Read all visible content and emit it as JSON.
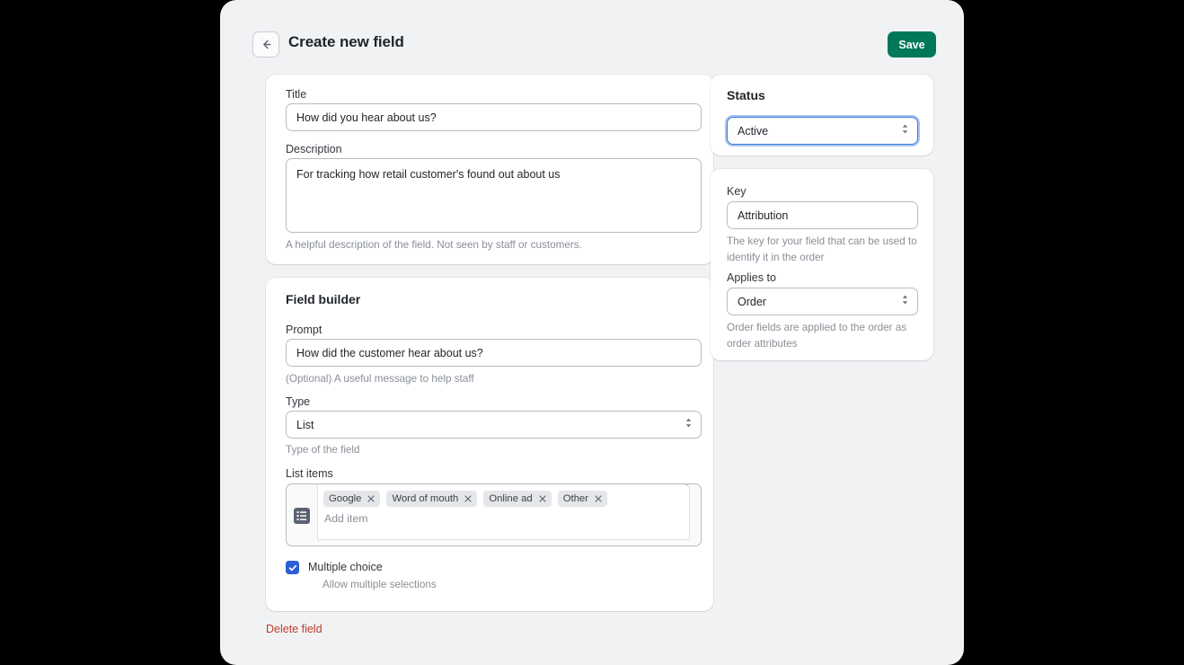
{
  "header": {
    "back_icon": "arrow-left-icon",
    "title": "Create new field",
    "save_label": "Save"
  },
  "basic": {
    "title_label": "Title",
    "title_value": "How did you hear about us?",
    "title_placeholder": "",
    "description_label": "Description",
    "description_value": "For tracking how retail customer's found out about us",
    "description_placeholder": "",
    "description_help": "A helpful description of the field. Not seen by staff or customers."
  },
  "builder": {
    "section_title": "Field builder",
    "prompt_label": "Prompt",
    "prompt_value": "How did the customer hear about us?",
    "prompt_placeholder": "",
    "prompt_help": "(Optional) A useful message to help staff",
    "type_label": "Type",
    "type_value": "List",
    "type_options": [
      "List"
    ],
    "type_help": "Type of the field",
    "list_items_label": "List items",
    "list_icon": "list-icon",
    "items": [
      {
        "label": "Google",
        "remove_icon": "close-icon"
      },
      {
        "label": "Word of mouth",
        "remove_icon": "close-icon"
      },
      {
        "label": "Online ad",
        "remove_icon": "close-icon"
      },
      {
        "label": "Other",
        "remove_icon": "close-icon"
      }
    ],
    "add_item_placeholder": "Add item",
    "add_item_value": "",
    "multiple_choice_label": "Multiple choice",
    "multiple_choice_help": "Allow multiple selections",
    "multiple_choice_checked": true,
    "checkbox_color": "#2c5fd6"
  },
  "status": {
    "label": "Status",
    "value": "Active",
    "options": [
      "Active"
    ],
    "focus_color": "#3b7ddd"
  },
  "meta": {
    "key_label": "Key",
    "key_value": "Attribution",
    "key_placeholder": "",
    "key_help": "The key for your field that can be used to identify it in the order",
    "applies_label": "Applies to",
    "applies_value": "Order",
    "applies_options": [
      "Order"
    ],
    "applies_help": "Order fields are applied to the order as order attributes"
  },
  "footer": {
    "delete_label": "Delete field",
    "delete_color": "#c0392b"
  },
  "theme": {
    "save_button_color": "#00785a",
    "page_background": "#000000",
    "modal_background": "#f1f2f4"
  }
}
